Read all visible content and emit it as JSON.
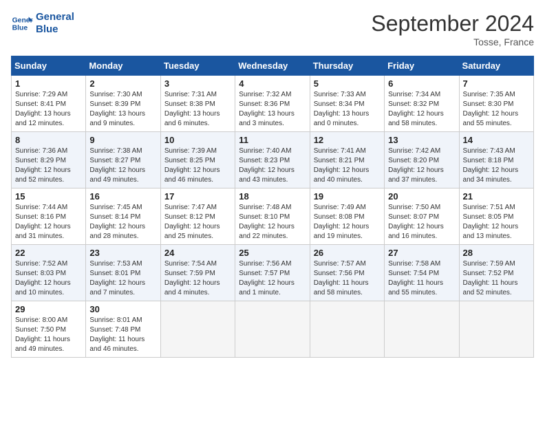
{
  "header": {
    "logo_line1": "General",
    "logo_line2": "Blue",
    "month": "September 2024",
    "location": "Tosse, France"
  },
  "columns": [
    "Sunday",
    "Monday",
    "Tuesday",
    "Wednesday",
    "Thursday",
    "Friday",
    "Saturday"
  ],
  "weeks": [
    [
      {
        "day": "1",
        "detail": "Sunrise: 7:29 AM\nSunset: 8:41 PM\nDaylight: 13 hours\nand 12 minutes."
      },
      {
        "day": "2",
        "detail": "Sunrise: 7:30 AM\nSunset: 8:39 PM\nDaylight: 13 hours\nand 9 minutes."
      },
      {
        "day": "3",
        "detail": "Sunrise: 7:31 AM\nSunset: 8:38 PM\nDaylight: 13 hours\nand 6 minutes."
      },
      {
        "day": "4",
        "detail": "Sunrise: 7:32 AM\nSunset: 8:36 PM\nDaylight: 13 hours\nand 3 minutes."
      },
      {
        "day": "5",
        "detail": "Sunrise: 7:33 AM\nSunset: 8:34 PM\nDaylight: 13 hours\nand 0 minutes."
      },
      {
        "day": "6",
        "detail": "Sunrise: 7:34 AM\nSunset: 8:32 PM\nDaylight: 12 hours\nand 58 minutes."
      },
      {
        "day": "7",
        "detail": "Sunrise: 7:35 AM\nSunset: 8:30 PM\nDaylight: 12 hours\nand 55 minutes."
      }
    ],
    [
      {
        "day": "8",
        "detail": "Sunrise: 7:36 AM\nSunset: 8:29 PM\nDaylight: 12 hours\nand 52 minutes."
      },
      {
        "day": "9",
        "detail": "Sunrise: 7:38 AM\nSunset: 8:27 PM\nDaylight: 12 hours\nand 49 minutes."
      },
      {
        "day": "10",
        "detail": "Sunrise: 7:39 AM\nSunset: 8:25 PM\nDaylight: 12 hours\nand 46 minutes."
      },
      {
        "day": "11",
        "detail": "Sunrise: 7:40 AM\nSunset: 8:23 PM\nDaylight: 12 hours\nand 43 minutes."
      },
      {
        "day": "12",
        "detail": "Sunrise: 7:41 AM\nSunset: 8:21 PM\nDaylight: 12 hours\nand 40 minutes."
      },
      {
        "day": "13",
        "detail": "Sunrise: 7:42 AM\nSunset: 8:20 PM\nDaylight: 12 hours\nand 37 minutes."
      },
      {
        "day": "14",
        "detail": "Sunrise: 7:43 AM\nSunset: 8:18 PM\nDaylight: 12 hours\nand 34 minutes."
      }
    ],
    [
      {
        "day": "15",
        "detail": "Sunrise: 7:44 AM\nSunset: 8:16 PM\nDaylight: 12 hours\nand 31 minutes."
      },
      {
        "day": "16",
        "detail": "Sunrise: 7:45 AM\nSunset: 8:14 PM\nDaylight: 12 hours\nand 28 minutes."
      },
      {
        "day": "17",
        "detail": "Sunrise: 7:47 AM\nSunset: 8:12 PM\nDaylight: 12 hours\nand 25 minutes."
      },
      {
        "day": "18",
        "detail": "Sunrise: 7:48 AM\nSunset: 8:10 PM\nDaylight: 12 hours\nand 22 minutes."
      },
      {
        "day": "19",
        "detail": "Sunrise: 7:49 AM\nSunset: 8:08 PM\nDaylight: 12 hours\nand 19 minutes."
      },
      {
        "day": "20",
        "detail": "Sunrise: 7:50 AM\nSunset: 8:07 PM\nDaylight: 12 hours\nand 16 minutes."
      },
      {
        "day": "21",
        "detail": "Sunrise: 7:51 AM\nSunset: 8:05 PM\nDaylight: 12 hours\nand 13 minutes."
      }
    ],
    [
      {
        "day": "22",
        "detail": "Sunrise: 7:52 AM\nSunset: 8:03 PM\nDaylight: 12 hours\nand 10 minutes."
      },
      {
        "day": "23",
        "detail": "Sunrise: 7:53 AM\nSunset: 8:01 PM\nDaylight: 12 hours\nand 7 minutes."
      },
      {
        "day": "24",
        "detail": "Sunrise: 7:54 AM\nSunset: 7:59 PM\nDaylight: 12 hours\nand 4 minutes."
      },
      {
        "day": "25",
        "detail": "Sunrise: 7:56 AM\nSunset: 7:57 PM\nDaylight: 12 hours\nand 1 minute."
      },
      {
        "day": "26",
        "detail": "Sunrise: 7:57 AM\nSunset: 7:56 PM\nDaylight: 11 hours\nand 58 minutes."
      },
      {
        "day": "27",
        "detail": "Sunrise: 7:58 AM\nSunset: 7:54 PM\nDaylight: 11 hours\nand 55 minutes."
      },
      {
        "day": "28",
        "detail": "Sunrise: 7:59 AM\nSunset: 7:52 PM\nDaylight: 11 hours\nand 52 minutes."
      }
    ],
    [
      {
        "day": "29",
        "detail": "Sunrise: 8:00 AM\nSunset: 7:50 PM\nDaylight: 11 hours\nand 49 minutes."
      },
      {
        "day": "30",
        "detail": "Sunrise: 8:01 AM\nSunset: 7:48 PM\nDaylight: 11 hours\nand 46 minutes."
      },
      {
        "day": "",
        "detail": ""
      },
      {
        "day": "",
        "detail": ""
      },
      {
        "day": "",
        "detail": ""
      },
      {
        "day": "",
        "detail": ""
      },
      {
        "day": "",
        "detail": ""
      }
    ]
  ]
}
